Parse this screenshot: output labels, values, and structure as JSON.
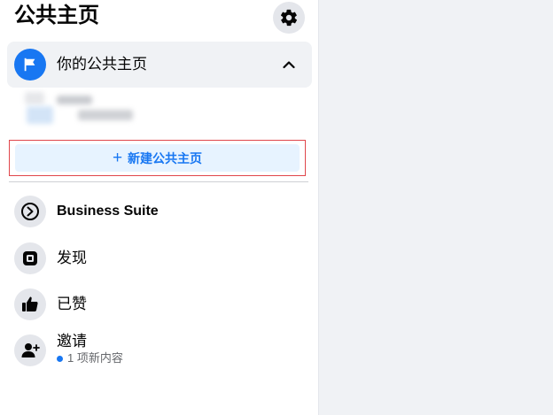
{
  "header": {
    "title": "公共主页",
    "settings_icon": "gear-icon"
  },
  "your_pages": {
    "label": "你的公共主页",
    "icon": "flag-icon",
    "expand_icon": "chevron-up-icon"
  },
  "create_page": {
    "label": "新建公共主页",
    "icon": "plus-icon"
  },
  "nav": {
    "items": [
      {
        "label": "Business Suite",
        "icon": "business-suite-icon"
      },
      {
        "label": "发现",
        "icon": "discover-icon"
      },
      {
        "label": "已赞",
        "icon": "thumbs-up-icon"
      },
      {
        "label": "邀请",
        "icon": "invite-person-icon"
      }
    ],
    "invite_sub": "1 项新内容"
  },
  "colors": {
    "accent": "#1877f2",
    "highlight_border": "#e0464b",
    "create_bg": "#e7f3ff",
    "right_bg": "#f0f2f5"
  }
}
